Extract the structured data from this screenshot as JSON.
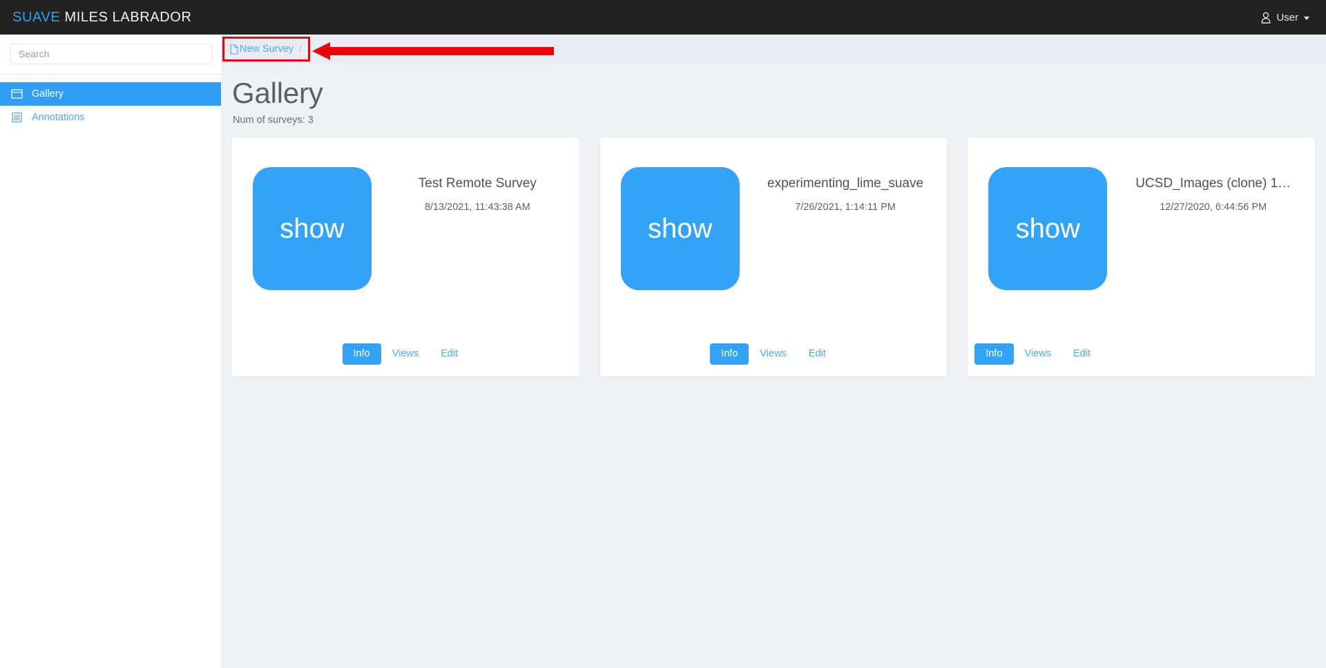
{
  "navbar": {
    "brand_accent": "SUAVE",
    "brand_rest": "MILES LABRADOR",
    "user_label": "User",
    "user_icon": "user-icon",
    "caret_icon": "chevron-down-icon",
    "background": "#222222",
    "accent": "#2e9ff2"
  },
  "sidebar": {
    "search": {
      "placeholder": "Search",
      "value": ""
    },
    "items": [
      {
        "label": "Gallery",
        "icon": "window-icon",
        "active": true
      },
      {
        "label": "Annotations",
        "icon": "list-icon",
        "active": false
      }
    ],
    "active_color": "#2f9ef4",
    "link_color": "#4aabf7"
  },
  "breadcrumb": {
    "link_label": "New Survey",
    "link_icon": "file-icon",
    "separator": "/",
    "highlight_color": "#e8040b",
    "bar_background": "#e9ecf2"
  },
  "annotation": {
    "type": "arrow-left",
    "color": "#e8040b"
  },
  "main": {
    "page_title": "Gallery",
    "survey_count_label": "Num of surveys: 3",
    "background": "#eef1f5",
    "thumb_label": "show",
    "thumb_color": "#33a3f7",
    "actions": [
      {
        "label": "Info",
        "active": true
      },
      {
        "label": "Views",
        "active": false
      },
      {
        "label": "Edit",
        "active": false
      }
    ],
    "surveys": [
      {
        "title": "Test Remote Survey",
        "date": "8/13/2021, 11:43:38 AM",
        "thumb_label": "show",
        "actions": [
          {
            "label": "Info",
            "active": true
          },
          {
            "label": "Views",
            "active": false
          },
          {
            "label": "Edit",
            "active": false
          }
        ]
      },
      {
        "title": "experimenting_lime_suave",
        "date": "7/26/2021, 1:14:11 PM",
        "thumb_label": "show",
        "actions": [
          {
            "label": "Info",
            "active": true
          },
          {
            "label": "Views",
            "active": false
          },
          {
            "label": "Edit",
            "active": false
          }
        ]
      },
      {
        "title": "UCSD_Images (clone) 1…",
        "date": "12/27/2020, 6:44:56 PM",
        "thumb_label": "show",
        "actions": [
          {
            "label": "Info",
            "active": true
          },
          {
            "label": "Views",
            "active": false
          },
          {
            "label": "Edit",
            "active": false
          }
        ]
      }
    ]
  }
}
